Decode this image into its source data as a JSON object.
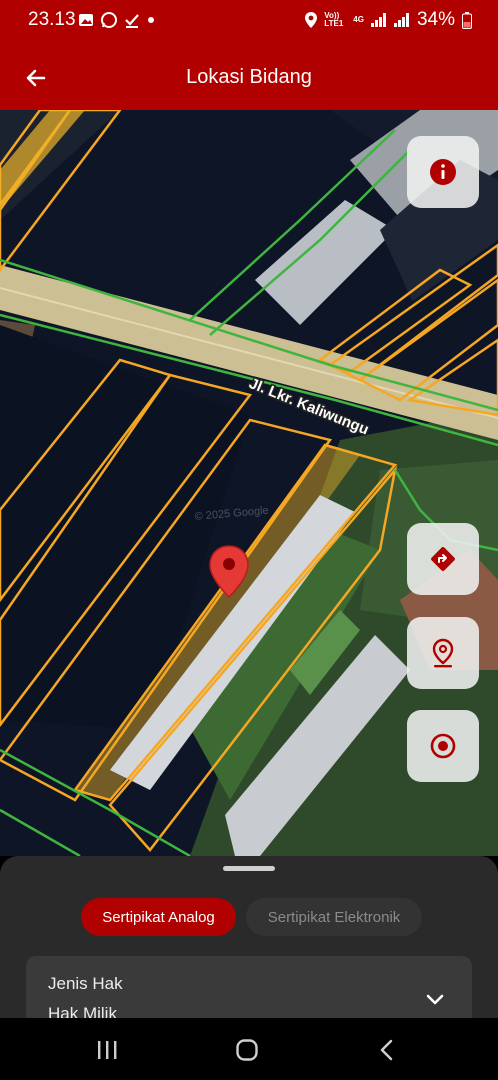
{
  "status_bar": {
    "time": "23.13",
    "battery": "34%",
    "network": "4G",
    "volte": "Vo)) LTE1"
  },
  "app_bar": {
    "title": "Lokasi Bidang",
    "back_icon": "arrow-left-icon"
  },
  "map": {
    "street_label": "Jl. Lkr. Kaliwungu",
    "watermark": "© 2025 Google",
    "parcel_outline_color": "#f5a623",
    "selected_parcel_fill": "#f0b429",
    "boundary_color": "#3fb53f",
    "marker_color": "#e53935"
  },
  "map_controls": [
    {
      "name": "info-button",
      "icon": "info-icon"
    },
    {
      "name": "directions-button",
      "icon": "directions-icon"
    },
    {
      "name": "parcel-location-button",
      "icon": "location-pin-icon"
    },
    {
      "name": "my-location-button",
      "icon": "target-icon"
    }
  ],
  "sheet": {
    "tabs": [
      {
        "label": "Sertipikat Analog",
        "active": true
      },
      {
        "label": "Sertipikat Elektronik",
        "active": false
      }
    ],
    "field": {
      "label": "Jenis Hak",
      "value": "Hak Milik"
    }
  },
  "colors": {
    "primary": "#b00000",
    "sheet_bg": "#2a2a2a",
    "card_bg": "#3a3a3a"
  }
}
